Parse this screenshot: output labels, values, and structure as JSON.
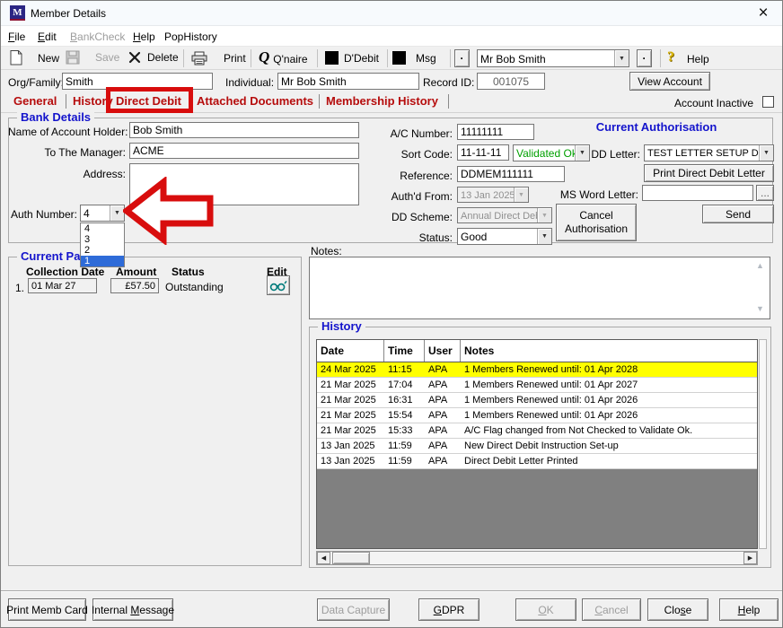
{
  "window": {
    "title": "Member Details"
  },
  "icons": {
    "app_initial": "M",
    "close_glyph": "×",
    "qnaire_glyph": "Q",
    "help_glyph": "?",
    "dot_glyph": "·",
    "combo_arrow": "▼",
    "scroll_up": "▲",
    "scroll_down": "▼",
    "scroll_left": "◀",
    "scroll_right": "▶",
    "ellipsis": "..."
  },
  "menu": {
    "file": {
      "key": "F",
      "post": "ile"
    },
    "edit": {
      "key": "E",
      "post": "dit"
    },
    "bankcheck": {
      "key": "B",
      "post": "ankCheck"
    },
    "help": {
      "key": "H",
      "post": "elp"
    },
    "pophistory": {
      "label": "PopHistory"
    }
  },
  "toolbar": {
    "new_label": "New",
    "save_label": "Save",
    "delete_label": "Delete",
    "print_label": "Print",
    "qnaire_label": "Q'naire",
    "ddebit_label": "D'Debit",
    "msg_label": "Msg",
    "member_value": "Mr Bob Smith",
    "help_label": "Help"
  },
  "header": {
    "org_family_label": "Org/Family:",
    "org_family_value": "Smith",
    "individual_label": "Individual:",
    "individual_value": "Mr Bob Smith",
    "record_id_label": "Record ID:",
    "record_id_value": "001075",
    "view_account_label": "View Account",
    "account_inactive_label": "Account Inactive"
  },
  "tabs": {
    "general": "General",
    "history": "History",
    "direct_debit": "Direct Debit",
    "attached_documents": "Attached Documents",
    "membership_history": "Membership History"
  },
  "bank_details": {
    "title": "Bank Details",
    "name_label": "Name of Account Holder:",
    "name_value": "Bob Smith",
    "manager_label": "To The Manager:",
    "manager_value": "ACME",
    "address_label": "Address:",
    "address_value": "",
    "auth_number_label": "Auth Number:",
    "auth_number_value": "4",
    "ac_number_label": "A/C Number:",
    "ac_number_value": "11111111",
    "sort_code_label": "Sort Code:",
    "sort_code_value": "11-11-11",
    "validated_value": "Validated Ok",
    "reference_label": "Reference:",
    "reference_value": "DDMEM111111",
    "authd_from_label": "Auth'd From:",
    "authd_from_value": "13 Jan 2025",
    "dd_scheme_label": "DD Scheme:",
    "dd_scheme_value": "Annual Direct Debit Sch",
    "status_label": "Status:",
    "status_value": "Good"
  },
  "auth_dropdown": {
    "items": [
      "4",
      "3",
      "2",
      "1"
    ],
    "selected_index": 3
  },
  "authorisation": {
    "title": "Current Authorisation",
    "dd_letter_label": "DD Letter:",
    "dd_letter_value": "TEST LETTER SETUP D",
    "print_letter_label": "Print Direct Debit Letter",
    "ms_word_label": "MS Word Letter:",
    "ms_word_value": "",
    "send_label": "Send",
    "cancel_line1": "Cancel",
    "cancel_line2": "Authorisation"
  },
  "current_payments": {
    "title": "Current Payments",
    "col_collection_date": "Collection Date",
    "col_amount": "Amount",
    "col_status": "Status",
    "col_edit": "Edit",
    "row_index": "1.",
    "collection_date": "01 Mar 27",
    "amount": "£57.50",
    "status": "Outstanding"
  },
  "notes": {
    "label": "Notes:",
    "value": ""
  },
  "history": {
    "title": "History",
    "columns": [
      "Date",
      "Time",
      "User",
      "Notes"
    ],
    "rows": [
      {
        "date": "24 Mar 2025",
        "time": "11:15",
        "user": "APA",
        "notes": "1 Members Renewed until: 01 Apr 2028",
        "highlighted": true
      },
      {
        "date": "21 Mar 2025",
        "time": "17:04",
        "user": "APA",
        "notes": "1 Members Renewed until: 01 Apr 2027"
      },
      {
        "date": "21 Mar 2025",
        "time": "16:31",
        "user": "APA",
        "notes": "1 Members Renewed until: 01 Apr 2026"
      },
      {
        "date": "21 Mar 2025",
        "time": "15:54",
        "user": "APA",
        "notes": "1 Members Renewed until: 01 Apr 2026"
      },
      {
        "date": "21 Mar 2025",
        "time": "15:33",
        "user": "APA",
        "notes": "A/C Flag changed from Not Checked to Validate Ok."
      },
      {
        "date": "13 Jan 2025",
        "time": "11:59",
        "user": "APA",
        "notes": "New Direct Debit Instruction Set-up"
      },
      {
        "date": "13 Jan 2025",
        "time": "11:59",
        "user": "APA",
        "notes": "Direct Debit Letter Printed"
      }
    ]
  },
  "footer": {
    "print_memb_card": "Print Memb Card",
    "internal_message": {
      "pre": "Internal ",
      "key": "M",
      "post": "essage"
    },
    "data_capture": "Data Capture",
    "gdpr": {
      "key": "G",
      "post": "DPR"
    },
    "ok": {
      "key": "O",
      "post": "K"
    },
    "cancel": {
      "key": "C",
      "post": "ancel"
    },
    "close": {
      "pre": "Clo",
      "key": "s",
      "post": "e"
    },
    "help": {
      "key": "H",
      "post": "elp"
    }
  },
  "colors": {
    "accent_red_tabs": "#b60d0d",
    "annotation_red": "#d80d0d",
    "heading_blue": "#1414cc",
    "validated_green": "#00a000",
    "highlight_yellow": "#ffff00",
    "selection_blue": "#2e6bd8",
    "table_filler_gray": "#808080"
  }
}
